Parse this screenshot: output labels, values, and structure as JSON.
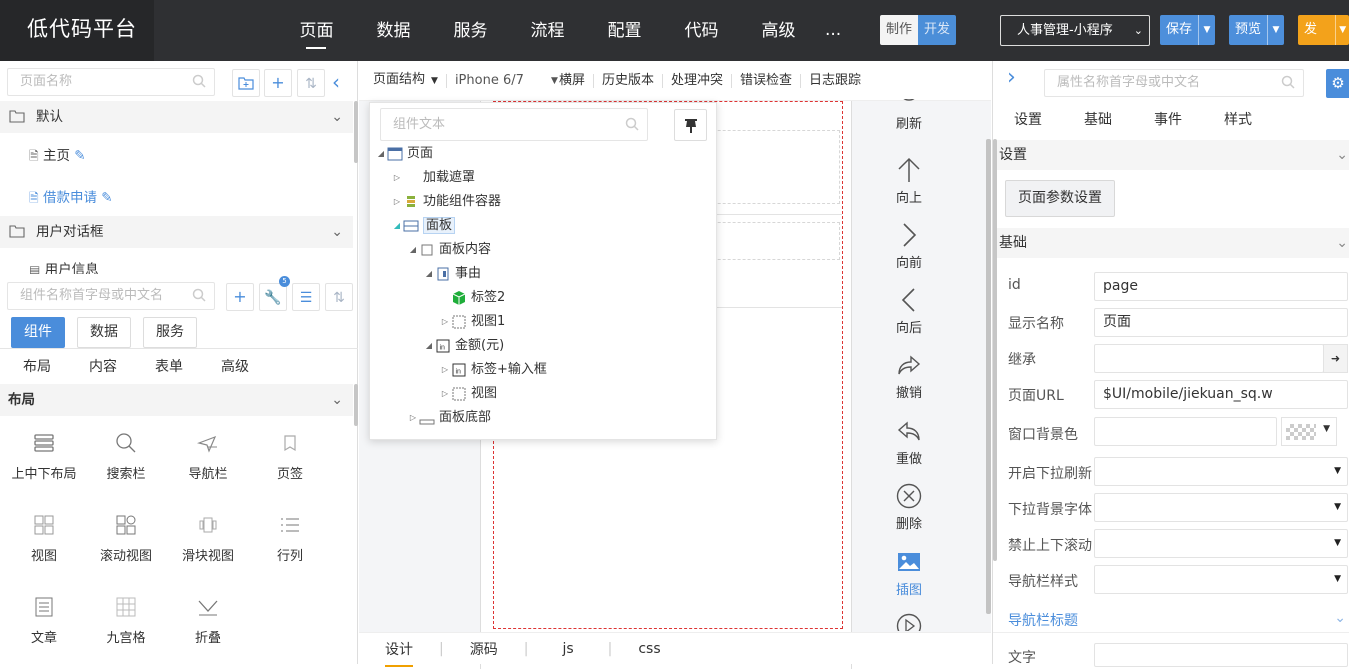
{
  "header": {
    "logo": "低代码平台",
    "nav": [
      "页面",
      "数据",
      "服务",
      "流程",
      "配置",
      "代码",
      "高级"
    ],
    "nav_more": "...",
    "mode": {
      "make": "制作",
      "dev": "开发"
    },
    "app_select": "人事管理-小程序",
    "save": "保存",
    "preview": "预览",
    "publish": "发布"
  },
  "left": {
    "page_search_placeholder": "页面名称",
    "groups": [
      {
        "label": "默认",
        "items": [
          "主页",
          "借款申请"
        ]
      },
      {
        "label": "用户对话框",
        "items": [
          "用户信息"
        ]
      }
    ],
    "comp_search_placeholder": "组件名称首字母或中文名",
    "badge": "5",
    "main_tabs": [
      "组件",
      "数据",
      "服务"
    ],
    "sub_tabs": [
      "布局",
      "内容",
      "表单",
      "高级"
    ],
    "section": "布局",
    "components": [
      "上中下布局",
      "搜索栏",
      "导航栏",
      "页签",
      "视图",
      "滚动视图",
      "滑块视图",
      "行列",
      "文章",
      "九宫格",
      "折叠"
    ]
  },
  "center": {
    "toolbar": {
      "structure": "页面结构",
      "device": "iPhone 6/7",
      "items": [
        "横屏",
        "历史版本",
        "处理冲突",
        "错误检查",
        "日志跟踪"
      ]
    },
    "tree": {
      "search_placeholder": "组件文本",
      "nodes": [
        "页面",
        "加载遮罩",
        "功能组件容器",
        "面板",
        "面板内容",
        "事由",
        "标签2",
        "视图1",
        "金额(元)",
        "标签+输入框",
        "视图",
        "面板底部"
      ]
    },
    "side_actions": [
      "刷新",
      "向上",
      "向前",
      "向后",
      "撤销",
      "重做",
      "删除",
      "插图"
    ],
    "bottom_tabs": [
      "设计",
      "源码",
      "js",
      "css"
    ]
  },
  "right": {
    "search_placeholder": "属性名称首字母或中文名",
    "tabs": [
      "设置",
      "基础",
      "事件",
      "样式"
    ],
    "section_settings": "设置",
    "page_param_btn": "页面参数设置",
    "section_basic": "基础",
    "props": [
      {
        "label": "id",
        "value": "page"
      },
      {
        "label": "显示名称",
        "value": "页面"
      },
      {
        "label": "继承",
        "value": ""
      },
      {
        "label": "页面URL",
        "value": "$UI/mobile/jiekuan_sq.w"
      },
      {
        "label": "窗口背景色",
        "value": ""
      },
      {
        "label": "开启下拉刷新",
        "value": ""
      },
      {
        "label": "下拉背景字体",
        "value": ""
      },
      {
        "label": "禁止上下滚动",
        "value": ""
      },
      {
        "label": "导航栏样式",
        "value": ""
      }
    ],
    "nav_title_section": "导航栏标题",
    "text_label": "文字"
  }
}
